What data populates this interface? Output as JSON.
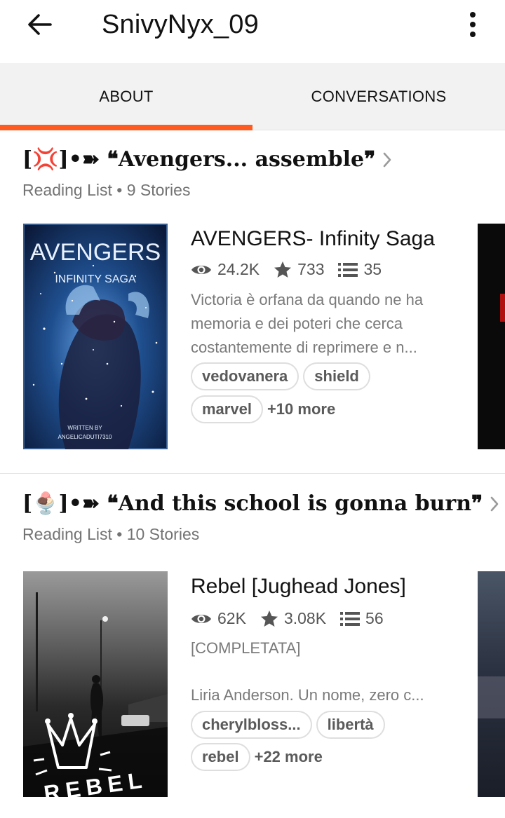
{
  "header": {
    "title": "SnivyNyx_09",
    "back_icon": "arrow-left-icon",
    "menu_icon": "more-vert-icon"
  },
  "tabs": [
    {
      "label": "ABOUT",
      "active": true
    },
    {
      "label": "CONVERSATIONS",
      "active": false
    }
  ],
  "accent_color": "#ff5a1f",
  "reading_lists": [
    {
      "title": "[💢]•➽ ❝Avengers... assemble❞",
      "subtitle": "Reading List • 9 Stories",
      "story": {
        "title": "AVENGERS- Infinity Saga",
        "reads": "24.2K",
        "votes": "733",
        "parts": "35",
        "status": "",
        "description": "Victoria è orfana da quando ne ha memoria e dei poteri che cerca costantemente di reprimere e n...",
        "tags": [
          "vedovanera",
          "shield",
          "marvel"
        ],
        "more": "+10 more",
        "cover": {
          "title": "AVENGERS",
          "subtitle": "INFINITY SAGA",
          "credit_line1": "WRITTEN BY",
          "credit_line2": "ANGELICADUTI7310"
        }
      }
    },
    {
      "title": "[🍨]•➽ ❝And this school is gonna burn❞",
      "subtitle": "Reading List • 10 Stories",
      "story": {
        "title": "Rebel [Jughead Jones]",
        "reads": "62K",
        "votes": "3.08K",
        "parts": "56",
        "status": "[COMPLETATA]",
        "description": "Liria Anderson. Un nome, zero c...",
        "tags": [
          "cherylbloss...",
          "libertà",
          "rebel"
        ],
        "more": "+22 more",
        "cover": {
          "title": "REBEL"
        }
      }
    }
  ]
}
